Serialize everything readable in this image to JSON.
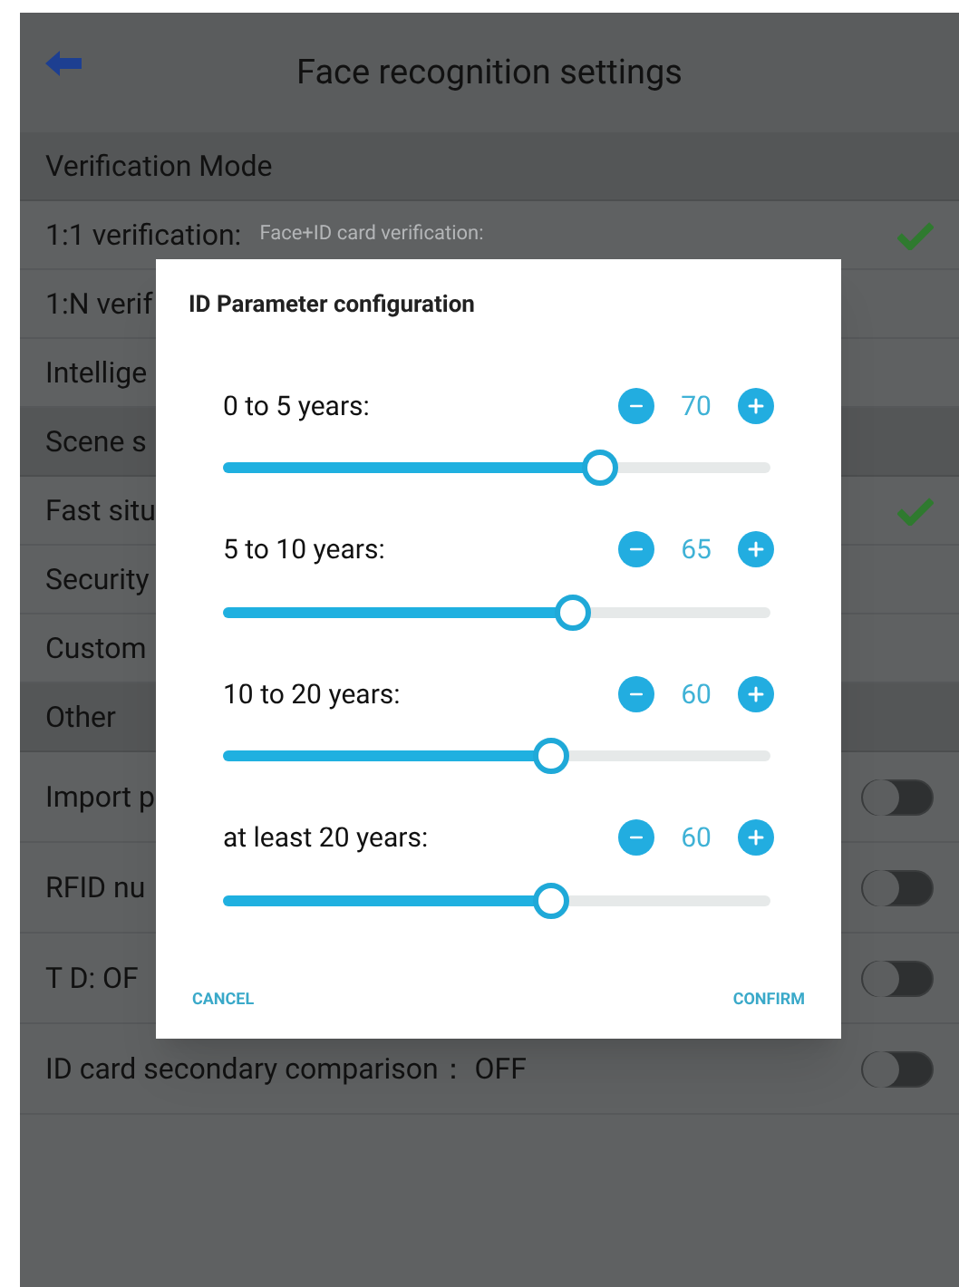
{
  "header": {
    "title": "Face recognition settings"
  },
  "settings": [
    {
      "kind": "section",
      "label": "Verification Mode"
    },
    {
      "kind": "option",
      "label": "1:1 verification:",
      "hint": "Face+ID card verification:",
      "checked": true
    },
    {
      "kind": "option",
      "label": "1:N verif",
      "checked": false
    },
    {
      "kind": "option",
      "label": "Intellige",
      "checked": false
    },
    {
      "kind": "section",
      "label": "Scene s"
    },
    {
      "kind": "option",
      "label": "Fast situ",
      "checked": true
    },
    {
      "kind": "option",
      "label": "Security",
      "checked": false
    },
    {
      "kind": "option",
      "label": "Custom",
      "checked": false
    },
    {
      "kind": "section",
      "label": "Other"
    },
    {
      "kind": "toggle",
      "label": "Import p",
      "on": false
    },
    {
      "kind": "toggle",
      "label": "RFID nu",
      "on": false
    },
    {
      "kind": "toggle",
      "label": "T D: OF",
      "on": false
    },
    {
      "kind": "toggle",
      "label": "ID card secondary comparison：  OFF",
      "on": false
    }
  ],
  "dialog": {
    "title": "ID Parameter configuration",
    "params": [
      {
        "label": "0 to 5 years:",
        "value": "70",
        "level": 0.69
      },
      {
        "label": "5 to 10 years:",
        "value": "65",
        "level": 0.64
      },
      {
        "label": "10 to 20 years:",
        "value": "60",
        "level": 0.6
      },
      {
        "label": "at least 20 years:",
        "value": "60",
        "level": 0.6
      }
    ],
    "buttons": [
      "CANCEL",
      "CONFIRM"
    ]
  }
}
